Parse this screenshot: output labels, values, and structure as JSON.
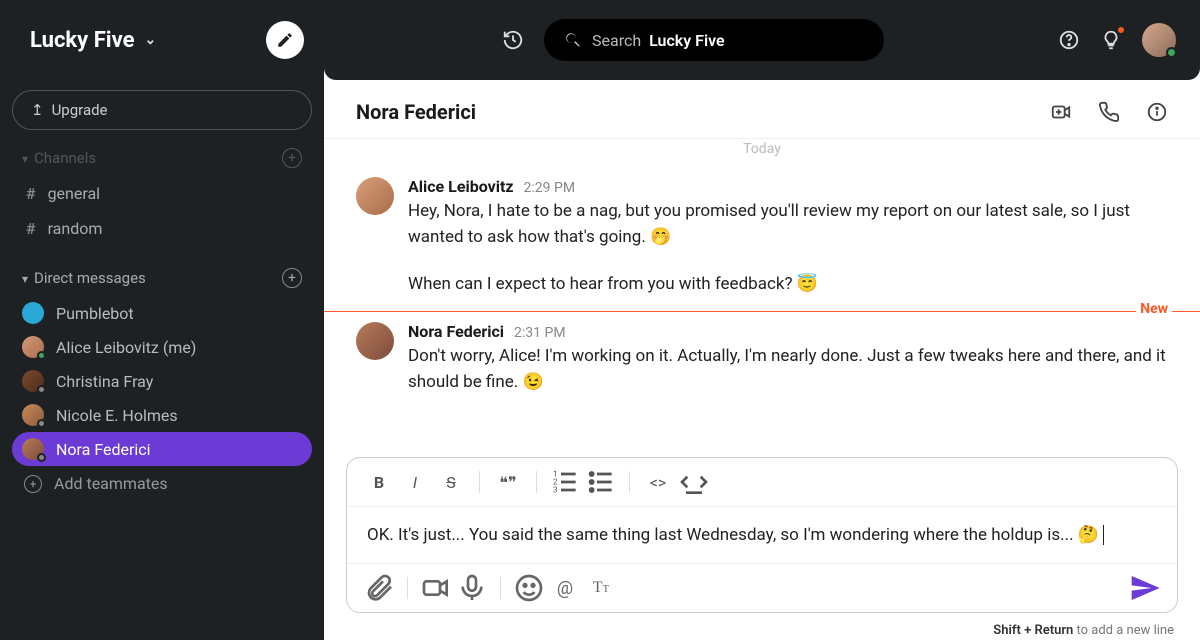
{
  "workspace": {
    "name": "Lucky Five"
  },
  "sidebar": {
    "upgrade_label": "Upgrade",
    "channels_label": "Channels",
    "channels": [
      {
        "name": "general"
      },
      {
        "name": "random"
      }
    ],
    "dm_label": "Direct messages",
    "dms": [
      {
        "name": "Pumblebot",
        "status": "none",
        "bot": true
      },
      {
        "name": "Alice Leibovitz (me)",
        "status": "online"
      },
      {
        "name": "Christina Fray",
        "status": "away"
      },
      {
        "name": "Nicole E. Holmes",
        "status": "away"
      },
      {
        "name": "Nora Federici",
        "status": "away",
        "active": true
      }
    ],
    "add_teammates_label": "Add teammates"
  },
  "topbar": {
    "search_label": "Search",
    "search_scope": "Lucky Five"
  },
  "conversation": {
    "title": "Nora Federici",
    "date_separator": "Today",
    "new_label": "New",
    "messages": [
      {
        "author": "Alice Leibovitz",
        "time": "2:29 PM",
        "text": "Hey, Nora, I hate to be a nag, but you promised you'll review my report on our latest sale, so I just wanted to ask how that's going. 🤭",
        "text2": "When can I expect to hear from you with feedback? 😇"
      },
      {
        "author": "Nora Federici",
        "time": "2:31 PM",
        "text": "Don't worry, Alice! I'm working on it. Actually, I'm nearly done. Just a few tweaks here and there, and it should be fine. 😉"
      }
    ]
  },
  "composer": {
    "draft": "OK. It's just... You said the same thing last Wednesday, so I'm wondering where the holdup is... 🤔"
  },
  "footer": {
    "hint_bold": "Shift + Return",
    "hint_rest": " to add a new line"
  }
}
